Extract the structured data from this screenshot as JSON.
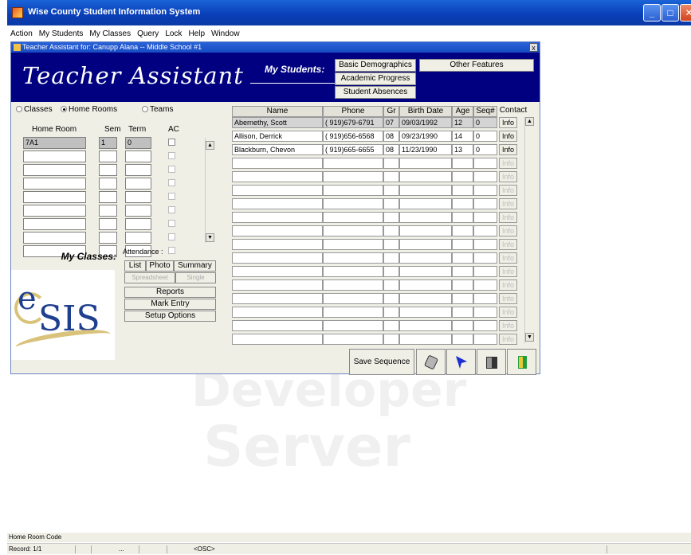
{
  "window": {
    "title": "Wise County Student Information System"
  },
  "menu": [
    "Action",
    "My Students",
    "My Classes",
    "Query",
    "Lock",
    "Help",
    "Window"
  ],
  "child": {
    "title": "Teacher Assistant for: Canupp Alana -- Middle School #1",
    "banner_title": "Teacher Assistant",
    "my_students_label": "My Students:",
    "buttons": {
      "basic_demographics": "Basic Demographics",
      "academic_progress": "Academic Progress",
      "student_absences": "Student Absences",
      "other_features": "Other Features"
    }
  },
  "view_mode": {
    "options": [
      "Classes",
      "Home Rooms",
      "Teams"
    ],
    "selected": "Home Rooms"
  },
  "homeroom_table": {
    "headers": {
      "home_room": "Home Room",
      "sem": "Sem",
      "term": "Term",
      "ac": "AC"
    },
    "first_row": {
      "home_room": "7A1",
      "sem": "1",
      "term": "0"
    }
  },
  "my_classes_label": "My Classes:",
  "logo": {
    "e": "e",
    "sis": "SIS"
  },
  "attendance": {
    "label": "Attendance :",
    "list": "List",
    "photo": "Photo",
    "summary": "Summary",
    "spreadsheet": "Spreadsheet",
    "single": "Single"
  },
  "actions": {
    "reports": "Reports",
    "mark_entry": "Mark Entry",
    "setup_options": "Setup Options"
  },
  "students_grid": {
    "headers": {
      "name": "Name",
      "phone": "Phone",
      "gr": "Gr",
      "birth": "Birth Date",
      "age": "Age",
      "seq": "Seq#",
      "contact": "Contact"
    },
    "rows": [
      {
        "name": "Abernethy, Scott",
        "phone": "( 919)679-6791",
        "gr": "07",
        "birth": "09/03/1992",
        "age": "12",
        "seq": "0",
        "info": "Info"
      },
      {
        "name": "Allison, Derrick",
        "phone": "( 919)656-6568",
        "gr": "08",
        "birth": "09/23/1990",
        "age": "14",
        "seq": "0",
        "info": "Info"
      },
      {
        "name": "Blackburn, Chevon",
        "phone": "( 919)665-6655",
        "gr": "08",
        "birth": "11/23/1990",
        "age": "13",
        "seq": "0",
        "info": "Info"
      }
    ],
    "empty_info": "Info"
  },
  "toolbar": {
    "save_sequence": "Save Sequence"
  },
  "status": {
    "field_hint": "Home Room Code",
    "record": "Record: 1/1",
    "osc": "<OSC>",
    "dots": "..."
  }
}
